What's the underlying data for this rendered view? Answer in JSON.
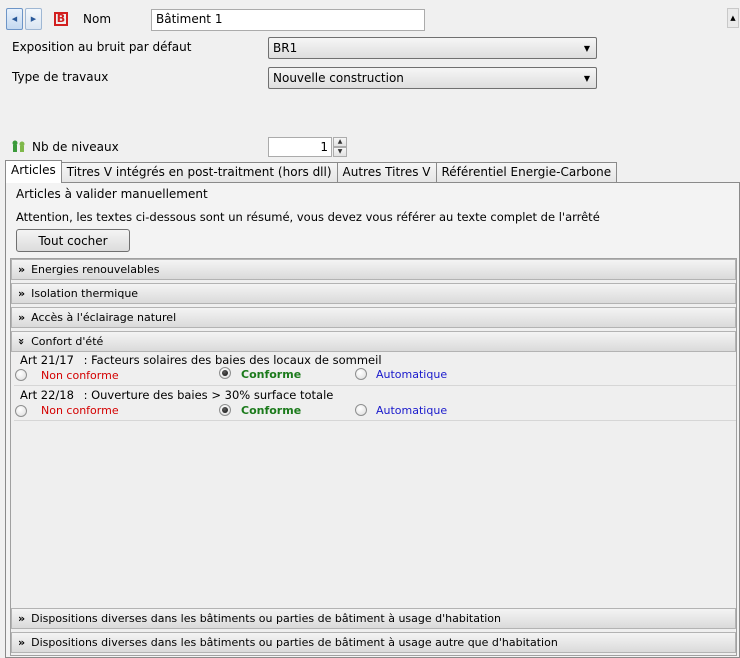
{
  "header": {
    "name_label": "Nom",
    "name_value": "Bâtiment 1",
    "b_icon_letter": "B"
  },
  "form": {
    "noise_label": "Exposition au bruit par défaut",
    "noise_value": "BR1",
    "works_label": "Type de travaux",
    "works_value": "Nouvelle construction",
    "levels_label": "Nb de niveaux",
    "levels_value": "1"
  },
  "tabs": [
    {
      "label": "Articles",
      "active": true
    },
    {
      "label": "Titres V intégrés en post-traitment (hors dll)",
      "active": false
    },
    {
      "label": "Autres Titres V",
      "active": false
    },
    {
      "label": "Référentiel Energie-Carbone",
      "active": false
    }
  ],
  "articles_panel": {
    "title": "Articles à valider manuellement",
    "notice": "Attention, les textes ci-dessous sont un résumé, vous devez vous référer au texte complet de l'arrêté",
    "check_all_label": "Tout cocher"
  },
  "sections": {
    "s1": {
      "label": "Energies renouvelables"
    },
    "s2": {
      "label": "Isolation thermique"
    },
    "s3": {
      "label": "Accès à l'éclairage naturel"
    },
    "s4": {
      "label": "Confort d'été"
    },
    "s5": {
      "label": "Dispositions diverses dans les bâtiments ou parties de bâtiment à usage d'habitation"
    },
    "s6": {
      "label": "Dispositions diverses dans les bâtiments ou parties de bâtiment à usage autre que d'habitation"
    }
  },
  "articles": [
    {
      "code": "Art 21/17",
      "title": ": Facteurs solaires des baies des locaux de sommeil",
      "options": [
        "Non conforme",
        "Conforme",
        "Automatique"
      ],
      "selected": "Conforme"
    },
    {
      "code": "Art 22/18",
      "title": ": Ouverture des baies > 30% surface totale",
      "options": [
        "Non conforme",
        "Conforme",
        "Automatique"
      ],
      "selected": "Conforme"
    }
  ],
  "colors": {
    "non_conforme": "#d40000",
    "conforme": "#1b7a1b",
    "automatique": "#1a1acc",
    "b_icon": "#d21f1f"
  }
}
